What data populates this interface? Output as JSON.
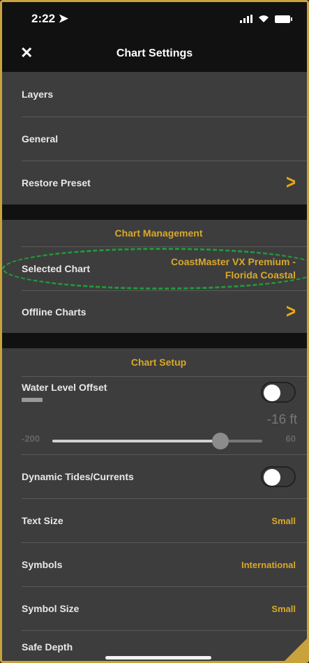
{
  "status": {
    "time": "2:22"
  },
  "header": {
    "title": "Chart Settings"
  },
  "menu": {
    "layers": "Layers",
    "general": "General",
    "restore_preset": "Restore Preset"
  },
  "chart_management": {
    "title": "Chart Management",
    "selected_label": "Selected Chart",
    "selected_value_line1": "CoastMaster VX Premium -",
    "selected_value_line2": "Florida Coastal",
    "offline_label": "Offline Charts"
  },
  "chart_setup": {
    "title": "Chart Setup",
    "water_level_offset": {
      "label": "Water Level Offset",
      "value": "-16 ft",
      "min": "-200",
      "max": "60",
      "slider_level": 0.8,
      "enabled": false
    },
    "dynamic_tides": {
      "label": "Dynamic Tides/Currents",
      "enabled": false
    },
    "text_size": {
      "label": "Text Size",
      "value": "Small"
    },
    "symbols": {
      "label": "Symbols",
      "value": "International"
    },
    "symbol_size": {
      "label": "Symbol Size",
      "value": "Small"
    },
    "safe_depth": {
      "label": "Safe Depth"
    }
  },
  "colors": {
    "accent": "#d9a82a",
    "highlight": "#1f9a3a"
  }
}
